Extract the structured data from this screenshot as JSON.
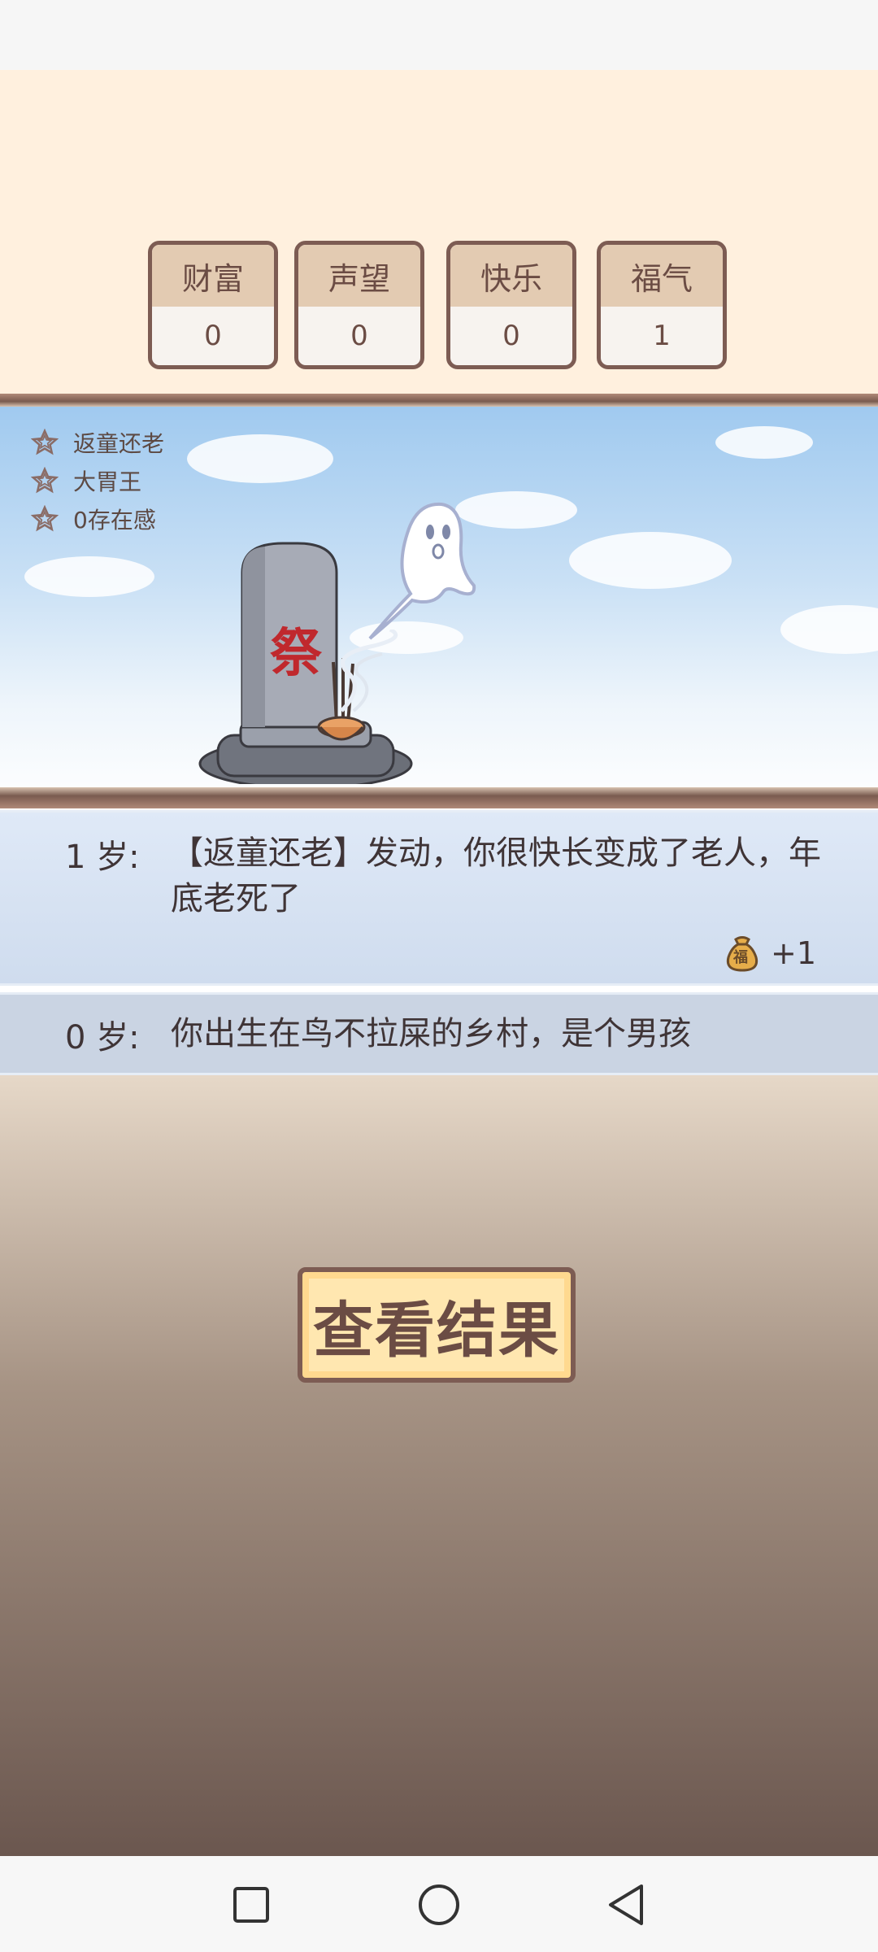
{
  "stats": [
    {
      "label": "财富",
      "value": "0"
    },
    {
      "label": "声望",
      "value": "0"
    },
    {
      "label": "快乐",
      "value": "0"
    },
    {
      "label": "福气",
      "value": "1"
    }
  ],
  "talents": [
    {
      "name": "返童还老",
      "icon": "star-outline-icon"
    },
    {
      "name": "大胃王",
      "icon": "star-outline-icon"
    },
    {
      "name": "0存在感",
      "icon": "star-outline-icon"
    }
  ],
  "scene": {
    "tombstone_char": "祭"
  },
  "log": [
    {
      "age": "1 岁:",
      "text": "【返童还老】发动，你很快长变成了老人，年底老死了",
      "reward_icon": "lucky-bag-icon",
      "reward_icon_char": "福",
      "reward": "+1"
    },
    {
      "age": "0 岁:",
      "text": "你出生在鸟不拉屎的乡村，是个男孩"
    }
  ],
  "buttons": {
    "view_result": "查看结果"
  },
  "colors": {
    "frame": "#7d5c53",
    "text": "#3f3436",
    "tomb_char": "#c0282d",
    "button_bg": "#ffe7b0"
  }
}
